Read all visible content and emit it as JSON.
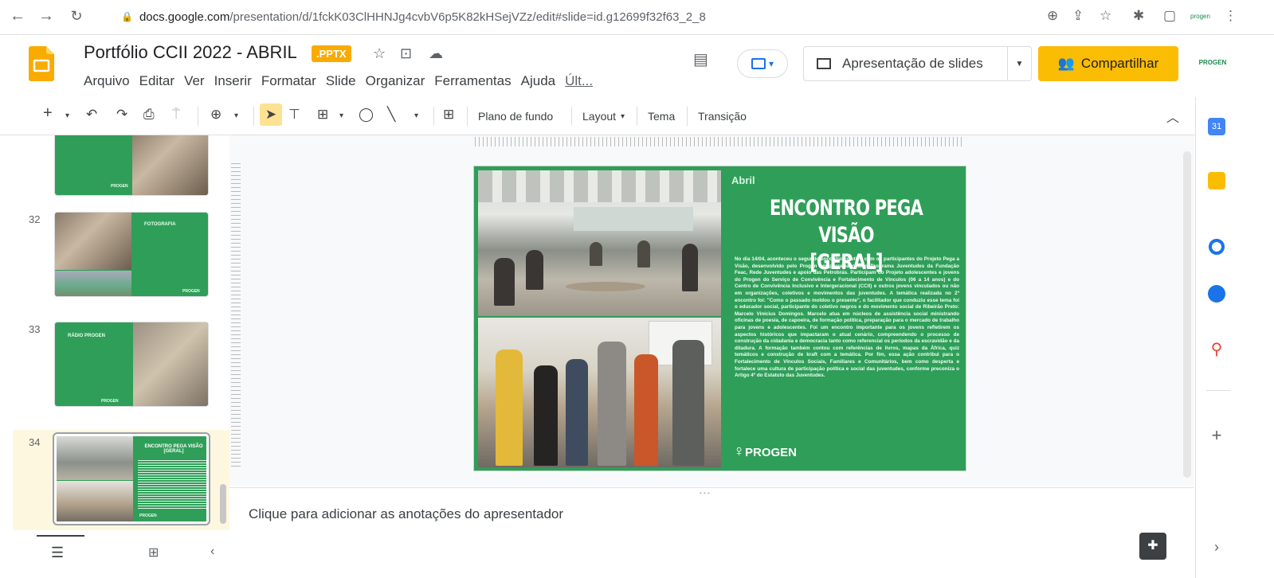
{
  "browser": {
    "url_host": "docs.google.com",
    "url_path": "/presentation/d/1fckK03ClHHNJg4cvbV6p5K82kHSejVZz/edit#slide=id.g12699f32f63_2_8"
  },
  "doc": {
    "title": "Portfólio CCII 2022 - ABRIL",
    "badge": ".PPTX"
  },
  "menus": [
    "Arquivo",
    "Editar",
    "Ver",
    "Inserir",
    "Formatar",
    "Slide",
    "Organizar",
    "Ferramentas",
    "Ajuda",
    "Últ..."
  ],
  "header": {
    "slideshow_label": "Apresentação de slides",
    "share_label": "Compartilhar",
    "avatar_text": "PROGEN"
  },
  "toolbar": {
    "background": "Plano de fundo",
    "layout": "Layout",
    "theme": "Tema",
    "transition": "Transição"
  },
  "filmstrip": {
    "slides": [
      {
        "number": "32",
        "title": "FOTOGRAFIA"
      },
      {
        "number": "33",
        "title": "RÁDIO PROGEN"
      },
      {
        "number": "34",
        "title": "ENCONTRO PEGA VISÃO [GERAL]"
      }
    ],
    "logo": "PROGEN"
  },
  "slide": {
    "month": "Abril",
    "title_line1": "ENCONTRO PEGA VISÃO",
    "title_line2": "[GERAL]",
    "body": "No dia 14/04, aconteceu o segundo encontro coletivo com os participantes do Projeto Pega a Visão, desenvolvido pelo Progen em parceria com o Programa Juventudes da Fundação Feac, Rede Juventudes e apoio das Petrobrás. Participam do Projeto adolescentes e jovens do Progen do Serviço de Convivência e Fortalecimento de Vínculos (06 a 14 anos) e do Centro de Convivência Inclusivo e Intergeracional (CCII) e outros jovens vinculados ou não em organizações, coletivos e movimentos das juventudes. A temática realizada no 2º encontro foi: \"Como o passado moldou o presente\", o facilitador que conduziu esse tema foi o educador social, participante do coletivo negros e do movimento social de Ribeirão Preto: Marcelo Vinícius Domingos. Marcelo atua em núcleos de assistência social ministrando oficinas de poesia, de capoeira, de formação política, preparação para o mercado de trabalho para jovens e adolescentes. Foi um encontro importante para os jovens refletirem os aspectos históricos que impactaram o atual cenário, compreendendo o processo de construção da cidadania e democracia tanto como referencial os períodos da escravidão e da ditadura. A formação também contou com referências de livros, mapas da África, quiz temáticos e construção de kraft com a temática. Por fim, essa ação contribui para o Fortalecimento de Vínculos Sociais, Familiares e Comunitários, bem como desperta e fortalece uma cultura de participação política e social das juventudes, conforme preconiza o Artigo 4º do Estatuto das Juventudes.",
    "logo": "PROGEN"
  },
  "notes": {
    "placeholder": "Clique para adicionar as anotações do apresentador"
  },
  "colors": {
    "slide_green": "#2f9e58",
    "share_yellow": "#fbbc04",
    "accent_blue": "#1a73e8"
  }
}
